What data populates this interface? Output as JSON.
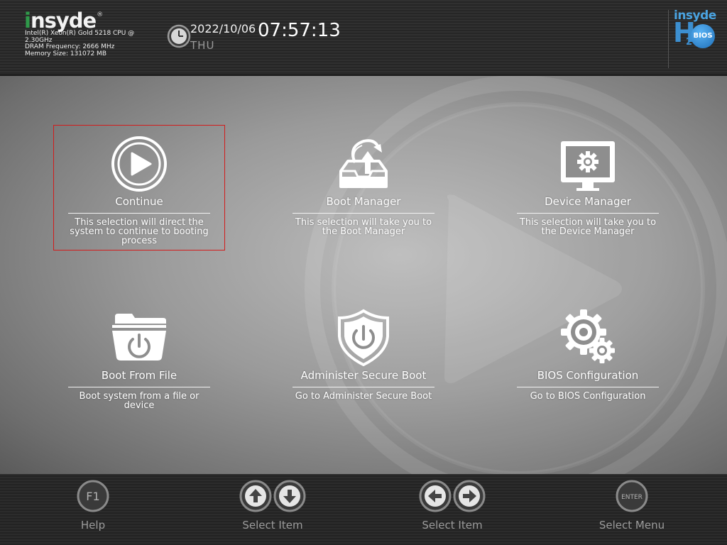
{
  "header": {
    "logo_text": "insyde",
    "logo_reg": "®",
    "cpu": "Intel(R) Xeon(R) Gold 5218 CPU @ 2.30GHz",
    "dram": "DRAM Frequency: 2666 MHz",
    "memory": "Memory Size: 131072 MB",
    "date": "2022/10/06",
    "day": "THU",
    "time": "07:57:13",
    "h2_logo": {
      "insyde": "insyde",
      "h": "H",
      "sub": "2",
      "bios": "BIOS"
    }
  },
  "menu": {
    "selected_index": 0,
    "items": [
      {
        "label": "Continue",
        "description": "This selection will direct the system to continue to booting process",
        "icon": "play-circle-icon"
      },
      {
        "label": "Boot Manager",
        "description": "This selection will take you to the Boot Manager",
        "icon": "boot-tray-icon"
      },
      {
        "label": "Device Manager",
        "description": "This selection will take you to the Device Manager",
        "icon": "monitor-gear-icon"
      },
      {
        "label": "Boot From File",
        "description": "Boot system from a file or device",
        "icon": "folder-power-icon"
      },
      {
        "label": "Administer Secure Boot",
        "description": "Go to Administer Secure Boot",
        "icon": "shield-power-icon"
      },
      {
        "label": "BIOS Configuration",
        "description": "Go to BIOS Configuration",
        "icon": "gears-icon"
      }
    ]
  },
  "footer": {
    "hints": [
      {
        "keys": [
          "F1"
        ],
        "label": "Help"
      },
      {
        "keys": [
          "up-arrow",
          "down-arrow"
        ],
        "label": "Select Item"
      },
      {
        "keys": [
          "left-arrow",
          "right-arrow"
        ],
        "label": "Select Item"
      },
      {
        "keys": [
          "ENTER"
        ],
        "label": "Select Menu"
      }
    ]
  },
  "colors": {
    "selection_border": "#d21c1c",
    "insyde_green": "#2f9a4a",
    "h2_blue": "#3c8fd0",
    "footer_label": "#9c9c9c"
  }
}
